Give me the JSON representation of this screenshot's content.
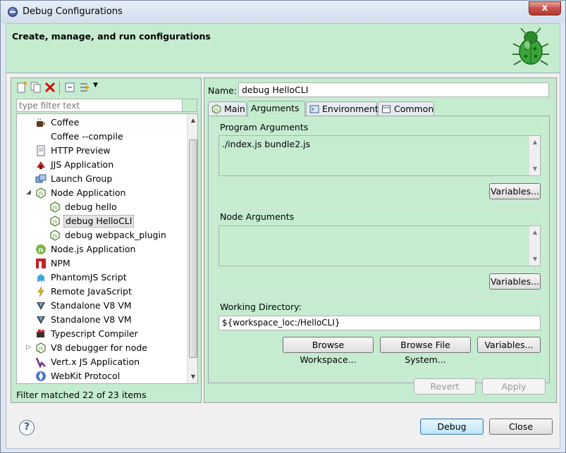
{
  "window": {
    "title": "Debug Configurations",
    "close_glyph": "x"
  },
  "banner": {
    "title": "Create, manage, and run configurations",
    "icon": "bug-icon"
  },
  "filter": {
    "placeholder": "type filter text"
  },
  "tree": {
    "items": [
      {
        "label": "Coffee",
        "icon": "coffee-icon"
      },
      {
        "label": "Coffee --compile",
        "icon": "none"
      },
      {
        "label": "HTTP Preview",
        "icon": "http-preview-icon"
      },
      {
        "label": "JJS Application",
        "icon": "jjs-icon"
      },
      {
        "label": "Launch Group",
        "icon": "launch-group-icon"
      },
      {
        "label": "Node Application",
        "icon": "node-icon",
        "expanded": true
      },
      {
        "label": "debug hello",
        "icon": "node-icon"
      },
      {
        "label": "debug HelloCLI",
        "icon": "node-icon",
        "selected": true
      },
      {
        "label": "debug webpack_plugin",
        "icon": "node-icon"
      },
      {
        "label": "Node.js Application",
        "icon": "nodejs-icon"
      },
      {
        "label": "NPM",
        "icon": "npm-icon"
      },
      {
        "label": "PhantomJS Script",
        "icon": "phantomjs-icon"
      },
      {
        "label": "Remote JavaScript",
        "icon": "remote-js-icon"
      },
      {
        "label": "Standalone V8 VM",
        "icon": "v8-icon"
      },
      {
        "label": "Standalone V8 VM",
        "icon": "v8-icon"
      },
      {
        "label": "Typescript Compiler",
        "icon": "typescript-icon"
      },
      {
        "label": "V8 debugger for node",
        "icon": "node-icon",
        "collapsed": true
      },
      {
        "label": "Vert.x JS Application",
        "icon": "vertx-icon"
      },
      {
        "label": "WebKit Protocol",
        "icon": "webkit-icon"
      }
    ],
    "status": "Filter matched 22 of 23 items"
  },
  "config": {
    "name_label": "Name:",
    "name_value": "debug HelloCLI",
    "tabs": [
      {
        "label": "Main",
        "icon": "node-icon"
      },
      {
        "label": "Arguments",
        "icon": "none",
        "active": true
      },
      {
        "label": "Environment",
        "icon": "environment-icon"
      },
      {
        "label": "Common",
        "icon": "common-icon"
      }
    ],
    "program_args_label": "Program Arguments",
    "program_args_value": "./index.js bundle2.js",
    "node_args_label": "Node Arguments",
    "node_args_value": "",
    "working_dir_label": "Working Directory:",
    "working_dir_value": "${workspace_loc:/HelloCLI}",
    "variables_label": "Variables...",
    "browse_workspace_label": "Browse Workspace...",
    "browse_fs_label": "Browse File System...",
    "revert_label": "Revert",
    "apply_label": "Apply"
  },
  "footer": {
    "help_glyph": "?",
    "debug_label": "Debug",
    "close_label": "Close"
  },
  "colors": {
    "green_bg": "#c6ecd0",
    "dialog_bg": "#f0f0f0"
  }
}
